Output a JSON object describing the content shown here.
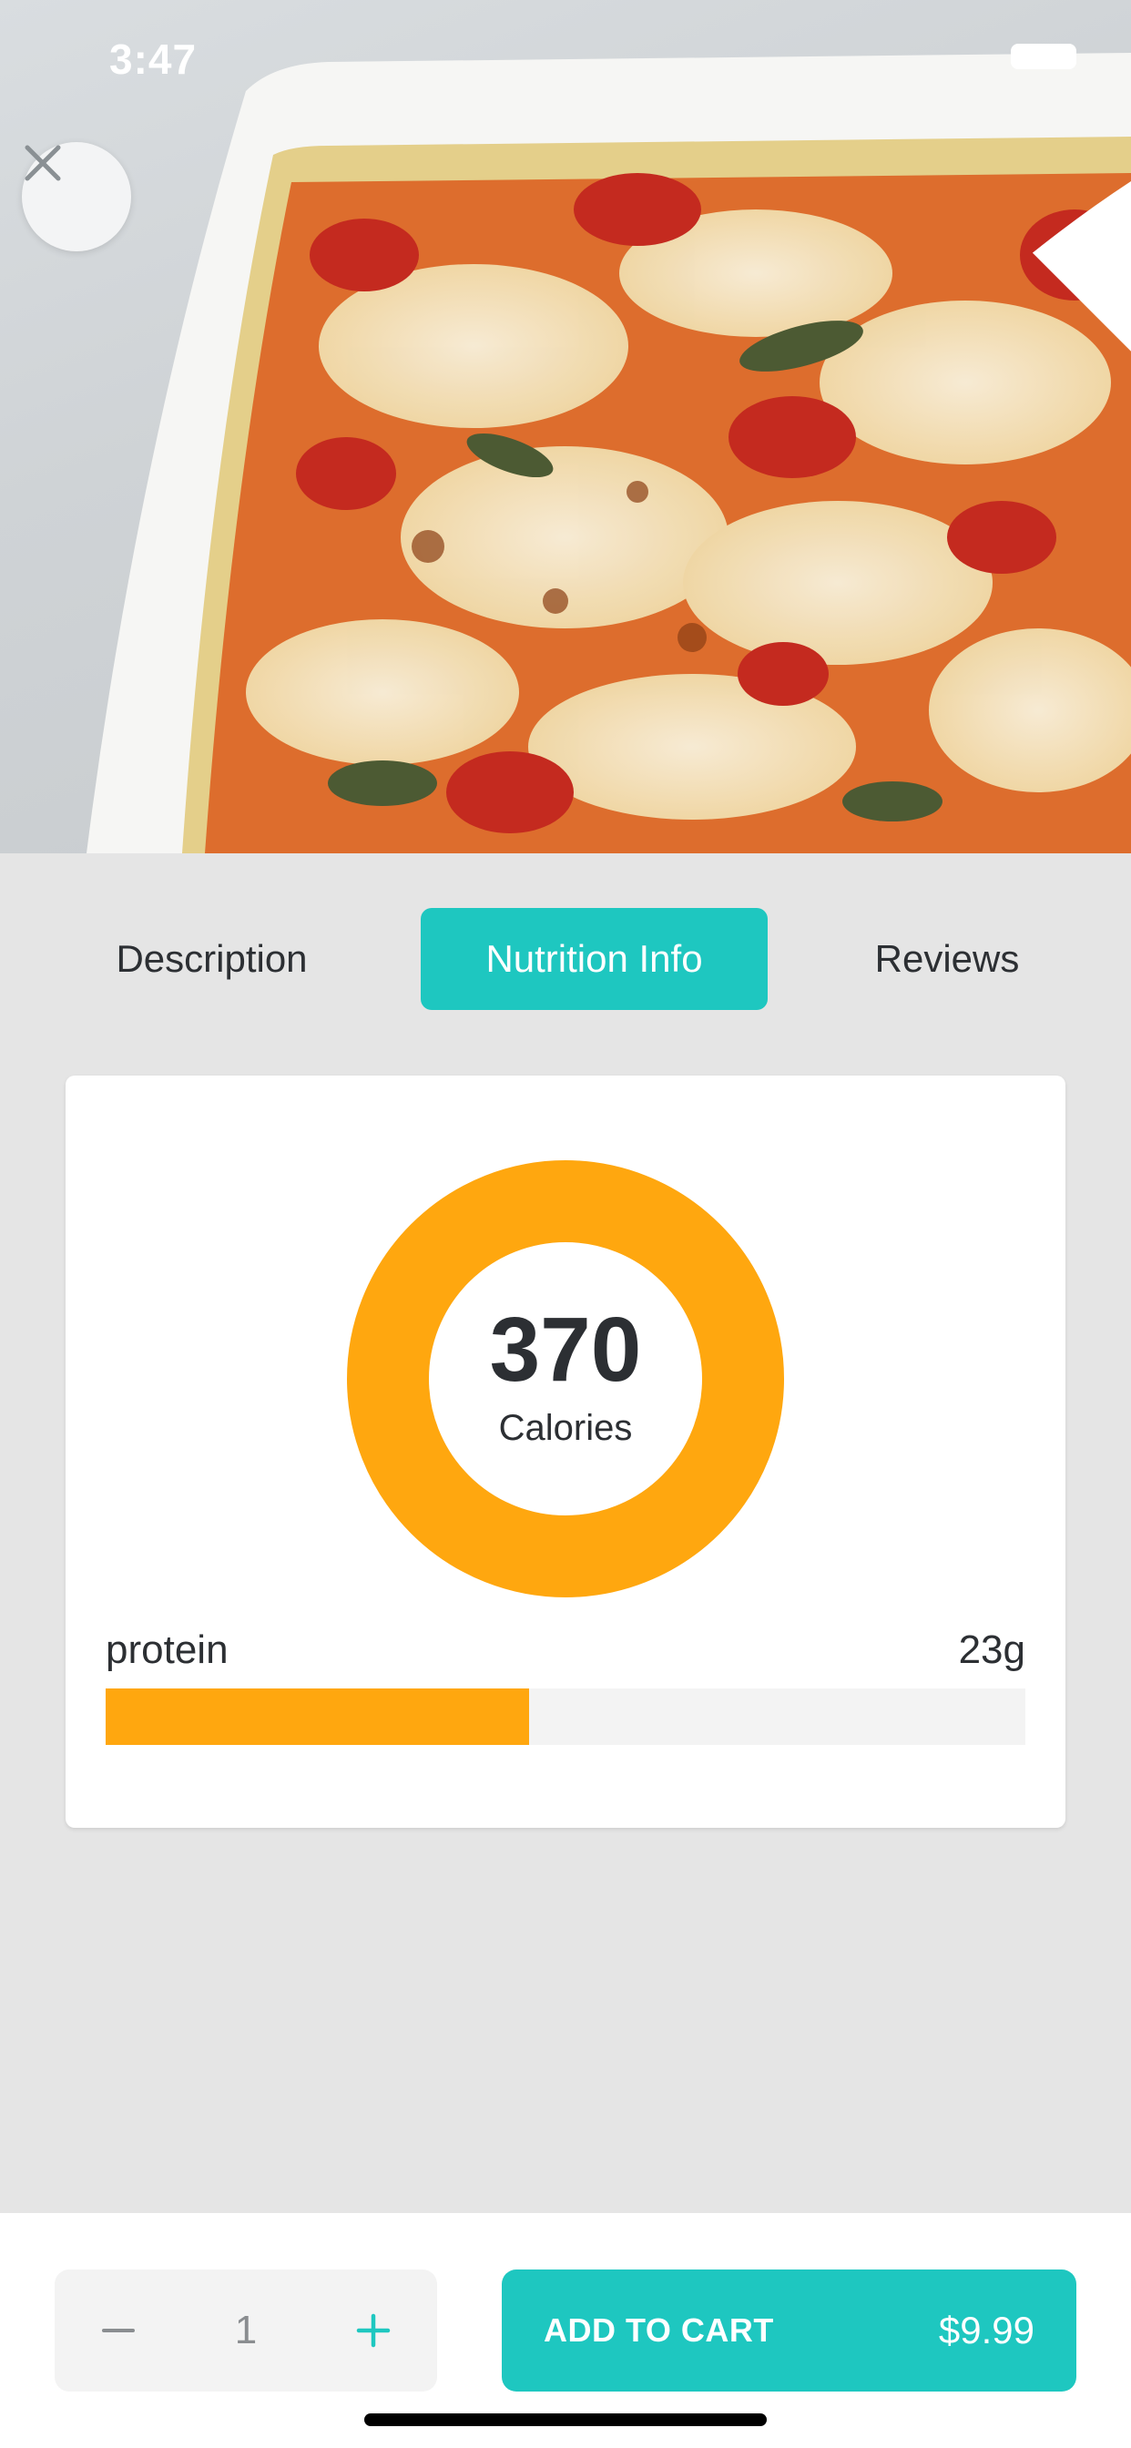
{
  "status_bar": {
    "time": "3:47"
  },
  "tabs": [
    {
      "label": "Description",
      "active": false
    },
    {
      "label": "Nutrition Info",
      "active": true
    },
    {
      "label": "Reviews",
      "active": false
    }
  ],
  "nutrition": {
    "calories_value": "370",
    "calories_label": "Calories",
    "macros": [
      {
        "label": "protein",
        "value": "23g",
        "fill_percent": 46
      }
    ]
  },
  "cart": {
    "quantity": "1",
    "add_label": "ADD TO CART",
    "price": "$9.99"
  },
  "icons": {
    "close": "close-icon",
    "minus": "minus-icon",
    "plus": "plus-icon",
    "wifi": "wifi-icon",
    "battery": "battery-icon"
  },
  "colors": {
    "accent": "#1ec7c0",
    "chart_orange": "#ffa70f",
    "background": "#e5e5e5",
    "text": "#2c2f33"
  }
}
